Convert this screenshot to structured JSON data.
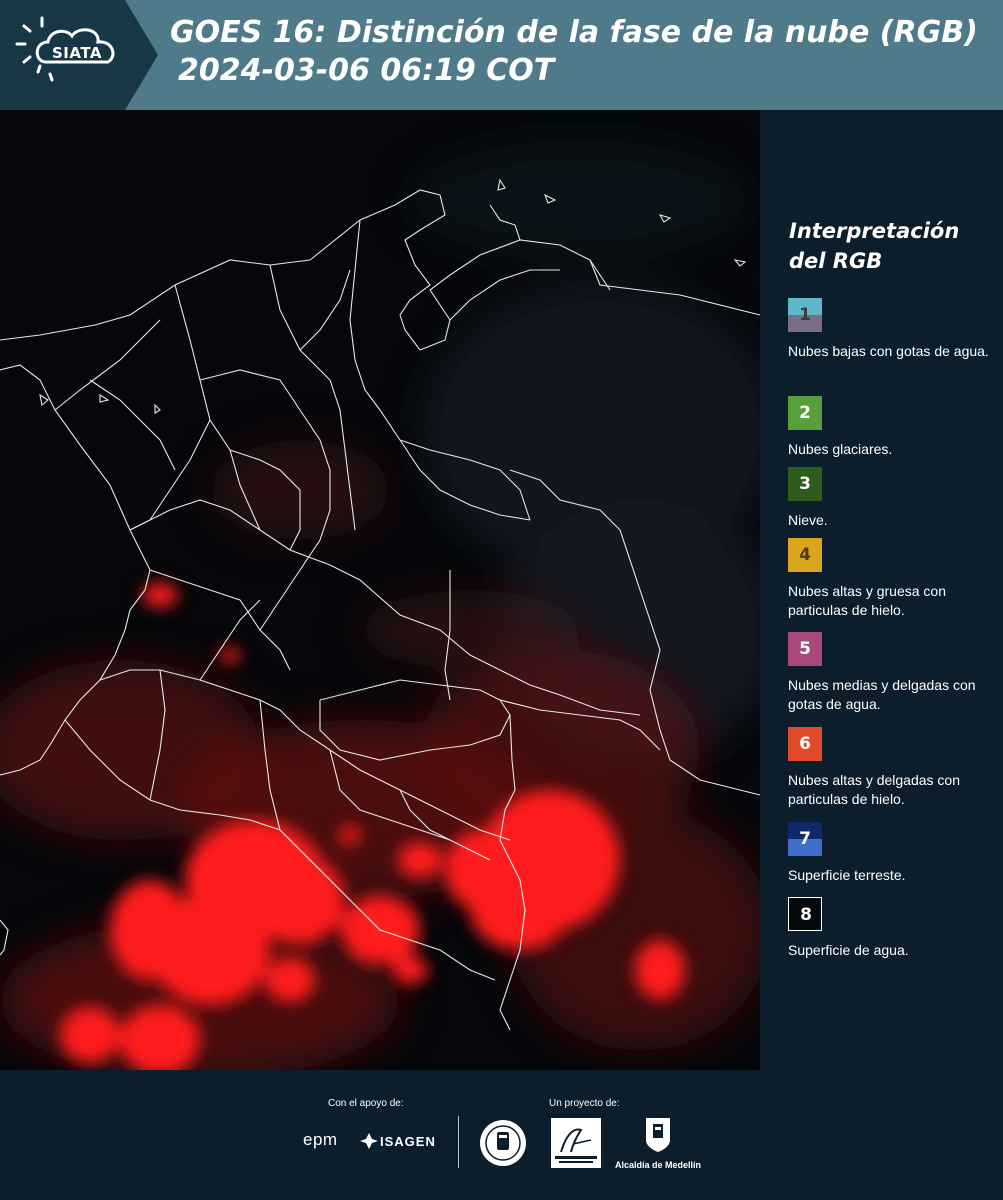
{
  "header": {
    "logo_text": "SIATA",
    "title": "GOES 16: Distinción de la fase de la nube (RGB)",
    "subtitle": "2024-03-06 06:19 COT"
  },
  "legend": {
    "title": "Interpretación del RGB",
    "items": [
      {
        "number": "1",
        "label": "Nubes bajas con gotas de agua.",
        "color_top": "#5fb8c8",
        "color_bottom": "#7a6e86",
        "text_color": "#3a3a46"
      },
      {
        "number": "2",
        "label": "Nubes glaciares.",
        "color_top": "#5aa03a",
        "color_bottom": "#5aa03a",
        "text_color": "#ffffff"
      },
      {
        "number": "3",
        "label": "Nieve.",
        "color_top": "#2e5c1e",
        "color_bottom": "#2e5c1e",
        "text_color": "#ffffff"
      },
      {
        "number": "4",
        "label": "Nubes altas y gruesa con particulas de hielo.",
        "color_top": "#d9a51e",
        "color_bottom": "#d9a51e",
        "text_color": "#4a3a10"
      },
      {
        "number": "5",
        "label": "Nubes medias y delgadas con gotas de agua.",
        "color_top": "#a8497a",
        "color_bottom": "#a8497a",
        "text_color": "#ffffff"
      },
      {
        "number": "6",
        "label": "Nubes altas y delgadas con particulas de hielo.",
        "color_top": "#e04a2a",
        "color_bottom": "#e04a2a",
        "text_color": "#ffffff"
      },
      {
        "number": "7",
        "label": "Superficie terreste.",
        "color_top": "#0e2a66",
        "color_bottom": "#3f6ec8",
        "text_color": "#ffffff"
      },
      {
        "number": "8",
        "label": "Superficie de agua.",
        "color_top": "#050b0c",
        "color_bottom": "#050b0c",
        "text_color": "#ffffff"
      }
    ]
  },
  "footer": {
    "support_label": "Con el apoyo de:",
    "project_label": "Un proyecto de:",
    "sponsors": [
      "epm",
      "ISAGEN"
    ],
    "partners": [
      "Área Metropolitana Valle de Aburrá",
      "Alcaldía de Medellín"
    ]
  },
  "colors": {
    "header_bg": "#4f7a8a",
    "panel_bg": "#0c1e2b",
    "cloud_red": "#ff1a1a"
  }
}
